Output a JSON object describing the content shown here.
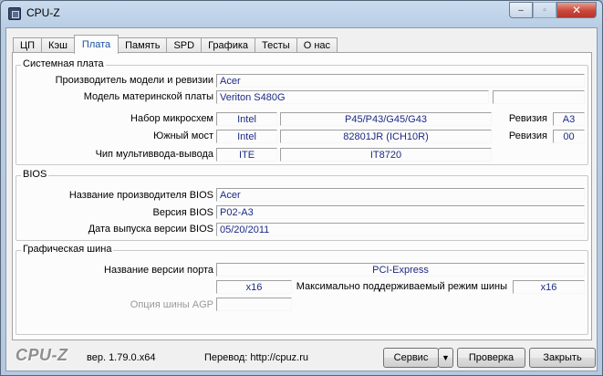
{
  "window": {
    "title": "CPU-Z",
    "minimize": "–",
    "maximize": "▫",
    "close": "✕"
  },
  "tabs": [
    {
      "label": "ЦП"
    },
    {
      "label": "Кэш"
    },
    {
      "label": "Плата"
    },
    {
      "label": "Память"
    },
    {
      "label": "SPD"
    },
    {
      "label": "Графика"
    },
    {
      "label": "Тесты"
    },
    {
      "label": "О нас"
    }
  ],
  "motherboard": {
    "title": "Системная плата",
    "manufacturer_label": "Производитель модели и ревизии",
    "manufacturer": "Acer",
    "model_label": "Модель материнской платы",
    "model": "Veriton S480G",
    "model_extra": "",
    "chipset_label": "Набор микросхем",
    "chipset_vendor": "Intel",
    "chipset": "P45/P43/G45/G43",
    "chipset_rev_label": "Ревизия",
    "chipset_rev": "A3",
    "southbridge_label": "Южный мост",
    "southbridge_vendor": "Intel",
    "southbridge": "82801JR (ICH10R)",
    "southbridge_rev_label": "Ревизия",
    "southbridge_rev": "00",
    "lpcio_label": "Чип мультиввода-вывода",
    "lpcio_vendor": "ITE",
    "lpcio": "IT8720"
  },
  "bios": {
    "title": "BIOS",
    "brand_label": "Название производителя BIOS",
    "brand": "Acer",
    "version_label": "Версия BIOS",
    "version": "P02-A3",
    "date_label": "Дата выпуска версии BIOS",
    "date": "05/20/2011"
  },
  "graphic_interface": {
    "title": "Графическая шина",
    "version_label": "Название версии порта",
    "version": "PCI-Express",
    "link_width": "x16",
    "max_supported_label": "Максимально поддерживаемый режим шины",
    "max_supported": "x16",
    "sideband_label": "Опция шины AGP",
    "sideband": ""
  },
  "footer": {
    "brand": "CPU-Z",
    "version": "вер. 1.79.0.x64",
    "translation": "Перевод: http://cpuz.ru",
    "service_button": "Сервис",
    "service_arrow": "▼",
    "validate_button": "Проверка",
    "close_button": "Закрыть"
  },
  "colors": {
    "value_text": "#1b2a85",
    "active_tab_text": "#1c4fa1",
    "close_button": "#c9473b"
  }
}
